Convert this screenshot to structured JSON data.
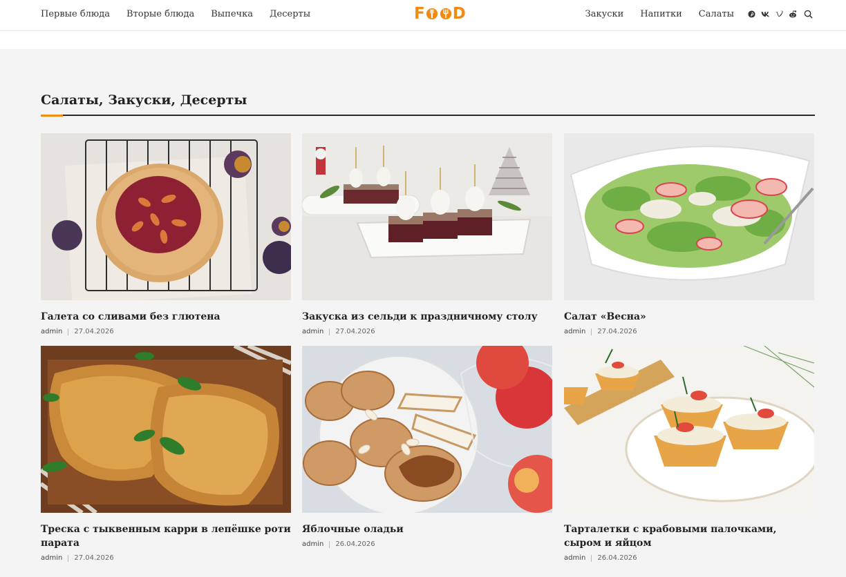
{
  "nav": {
    "left": [
      "Первые блюда",
      "Вторые блюда",
      "Выпечка",
      "Десерты"
    ],
    "right": [
      "Закуски",
      "Напитки",
      "Салаты"
    ],
    "social_icons": [
      "pinterest-icon",
      "vk-icon",
      "vimeo-icon",
      "reddit-icon"
    ]
  },
  "logo": {
    "text_left": "F",
    "text_right": "D",
    "color": "#f28b12"
  },
  "section": {
    "title": "Салаты, Закуски, Десерты",
    "accent_color": "#f28b12"
  },
  "posts": [
    {
      "title": "Галета со сливами без глютена",
      "author": "admin",
      "date": "27.04.2026",
      "image": "plum-galette-photo"
    },
    {
      "title": "Закуска из сельди к праздничному столу",
      "author": "admin",
      "date": "27.04.2026",
      "image": "herring-canapes-photo"
    },
    {
      "title": "Салат «Весна»",
      "author": "admin",
      "date": "27.04.2026",
      "image": "spring-salad-photo"
    },
    {
      "title": "Треска с тыквенным карри в лепёшке роти парата",
      "author": "admin",
      "date": "27.04.2026",
      "image": "roti-cod-photo"
    },
    {
      "title": "Яблочные оладьи",
      "author": "admin",
      "date": "26.04.2026",
      "image": "apple-pancakes-photo"
    },
    {
      "title": "Тарталетки с крабовыми палочками, сыром и яйцом",
      "author": "admin",
      "date": "26.04.2026",
      "image": "crab-tartlets-photo"
    }
  ]
}
